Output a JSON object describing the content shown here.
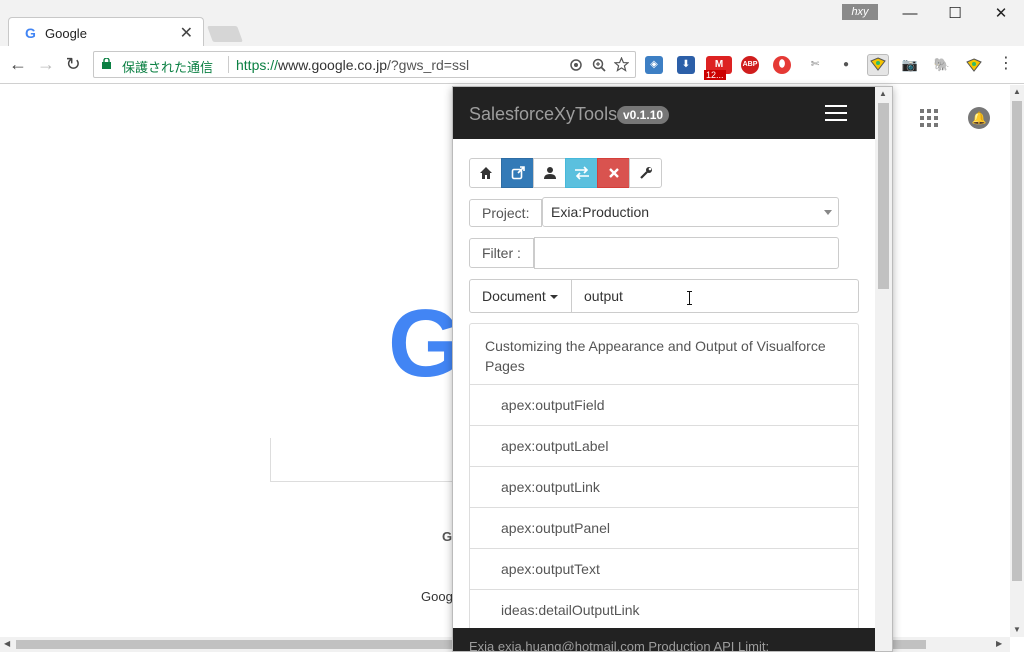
{
  "browser": {
    "tab_title": "Google",
    "tab_favicon": "G",
    "tab_close": "✕",
    "profile_name": "hxy",
    "window_controls": {
      "minimize": "—",
      "maximize": "☐",
      "close": "✕"
    },
    "nav": {
      "back": "←",
      "forward": "→",
      "reload": "↻"
    },
    "security_label": "保護された通信",
    "url_scheme": "https://",
    "url_host": "www.google.co.jp",
    "url_rest": "/?gws_rd=ssl",
    "omnibox_icons": [
      "location-icon",
      "zoom-icon",
      "star-icon"
    ],
    "extensions_menu": "⋮"
  },
  "extensions": {
    "gmail_count": "12..."
  },
  "google_page": {
    "logo_letter": "G",
    "button_text_fragment": "G",
    "footer_text_fragment": "Goog"
  },
  "popup": {
    "brand": "SalesforceXyTools",
    "version": "v0.1.10",
    "toolbar_buttons": [
      {
        "icon": "home-icon",
        "style": "default"
      },
      {
        "icon": "external-link-icon",
        "style": "primary"
      },
      {
        "icon": "user-icon",
        "style": "default"
      },
      {
        "icon": "switch-icon",
        "style": "info"
      },
      {
        "icon": "close-icon",
        "style": "danger"
      },
      {
        "icon": "wrench-icon",
        "style": "default"
      }
    ],
    "project_label": "Project:",
    "project_value": "Exia:Production",
    "filter_label": "Filter :",
    "filter_value": "",
    "search_type": "Document",
    "search_value": "output",
    "results": [
      "Customizing the Appearance and Output of Visualforce Pages",
      "apex:outputField",
      "apex:outputLabel",
      "apex:outputLink",
      "apex:outputPanel",
      "apex:outputText",
      "ideas:detailOutputLink"
    ],
    "footer_text": "Exia   exia.huang@hotmail.com   Production   API Limit:"
  },
  "colors": {
    "navbar": "#222222",
    "primary": "#337ab7",
    "info": "#5bc0de",
    "danger": "#d9534f",
    "secure_green": "#0b8043"
  }
}
